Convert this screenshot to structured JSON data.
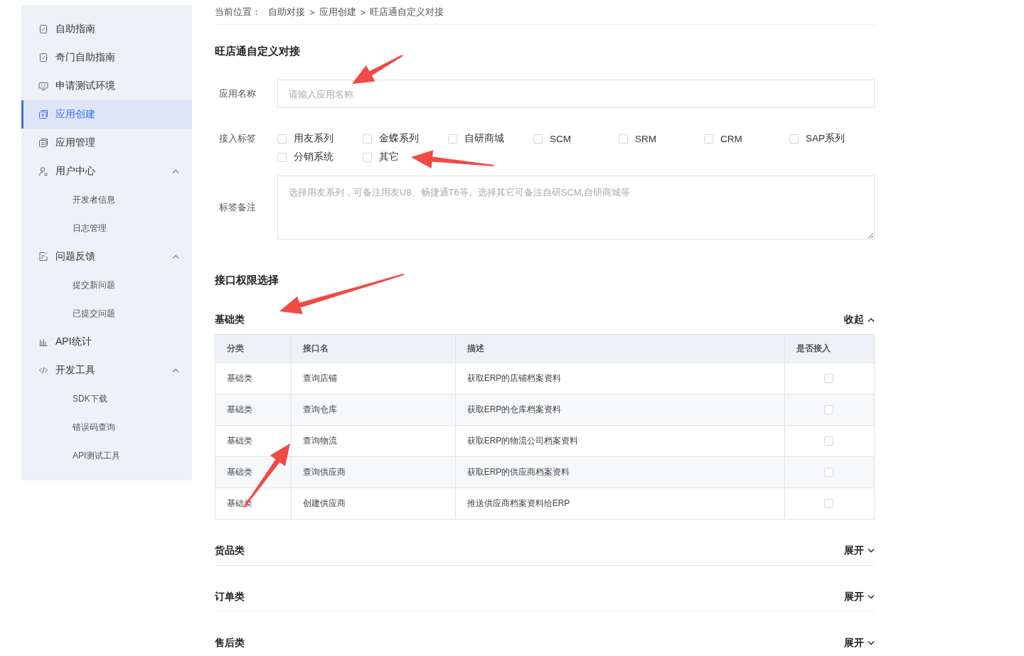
{
  "sidebar": {
    "items": [
      {
        "label": "自助指南",
        "selected": false
      },
      {
        "label": "奇门自助指南",
        "selected": false
      },
      {
        "label": "申请测试环境",
        "selected": false
      },
      {
        "label": "应用创建",
        "selected": true
      },
      {
        "label": "应用管理",
        "selected": false
      },
      {
        "label": "用户中心",
        "selected": false,
        "expanded": true,
        "children": [
          {
            "label": "开发者信息",
            "selected": false
          },
          {
            "label": "日志管理",
            "selected": false
          }
        ]
      },
      {
        "label": "问题反馈",
        "selected": false,
        "expanded": true,
        "children": [
          {
            "label": "提交新问题",
            "selected": false
          },
          {
            "label": "已提交问题",
            "selected": false
          }
        ]
      },
      {
        "label": "API统计",
        "selected": false
      },
      {
        "label": "开发工具",
        "selected": false,
        "expanded": true,
        "children": [
          {
            "label": "SDK下载",
            "selected": false
          },
          {
            "label": "错误码查询",
            "selected": false
          },
          {
            "label": "API测试工具",
            "selected": false
          }
        ]
      }
    ]
  },
  "breadcrumb": {
    "label": "当前位置：",
    "separator": ">",
    "items": [
      "自助对接",
      "应用创建",
      "旺店通自定义对接"
    ]
  },
  "page_title": "旺店通自定义对接",
  "form": {
    "app_name": {
      "label": "应用名称",
      "placeholder": "请输入应用名称"
    },
    "tags": {
      "label": "接入标签",
      "options": [
        {
          "label": "用友系列",
          "checked": false
        },
        {
          "label": "金蝶系列",
          "checked": false
        },
        {
          "label": "自研商城",
          "checked": false
        },
        {
          "label": "SCM",
          "checked": false
        },
        {
          "label": "SRM",
          "checked": false
        },
        {
          "label": "CRM",
          "checked": false
        },
        {
          "label": "SAP系列",
          "checked": false
        },
        {
          "label": "分销系统",
          "checked": false
        },
        {
          "label": "其它",
          "checked": false
        }
      ]
    },
    "tag_note": {
      "label": "标签备注",
      "placeholder": "选择用友系列，可备注用友U8、畅捷通T6等。选择其它可备注自研SCM,自研商城等"
    }
  },
  "permissions": {
    "title": "接口权限选择",
    "groups": [
      {
        "name": "基础类",
        "expanded": true,
        "toggle": "收起",
        "table": {
          "columns": [
            "分类",
            "接口名",
            "描述",
            "是否接入"
          ],
          "rows": [
            {
              "category": "基础类",
              "name": "查询店铺",
              "description": "获取ERP的店铺档案资料",
              "checked": false
            },
            {
              "category": "基础类",
              "name": "查询仓库",
              "description": "获取ERP的仓库档案资料",
              "checked": false
            },
            {
              "category": "基础类",
              "name": "查询物流",
              "description": "获取ERP的物流公司档案资料",
              "checked": false
            },
            {
              "category": "基础类",
              "name": "查询供应商",
              "description": "获取ERP的供应商档案资料",
              "checked": false
            },
            {
              "category": "基础类",
              "name": "创建供应商",
              "description": "推送供应商档案资料给ERP",
              "checked": false
            }
          ]
        }
      },
      {
        "name": "货品类",
        "expanded": false,
        "toggle": "展开"
      },
      {
        "name": "订单类",
        "expanded": false,
        "toggle": "展开"
      },
      {
        "name": "售后类",
        "expanded": false,
        "toggle": "展开"
      }
    ]
  }
}
